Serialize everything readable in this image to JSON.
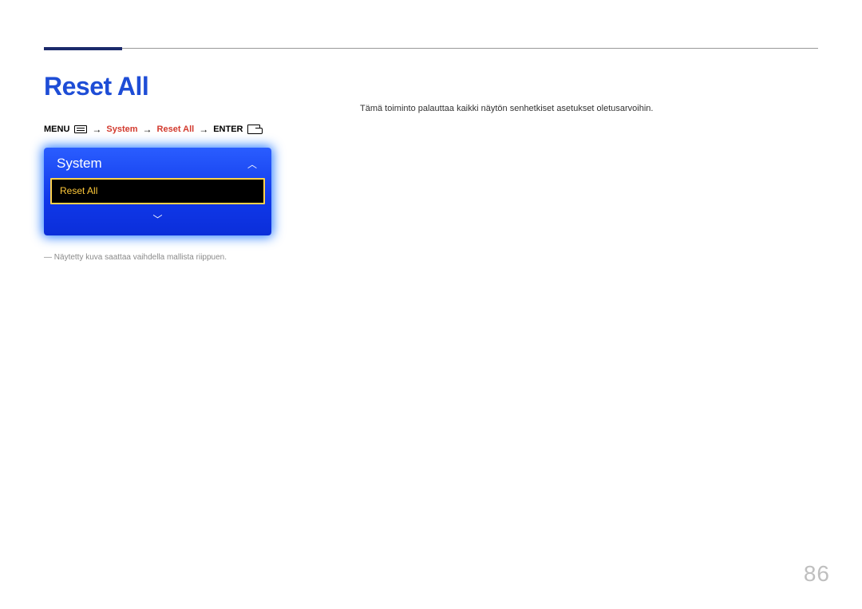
{
  "heading": "Reset All",
  "nav": {
    "menu_label": "MENU",
    "system_label": "System",
    "reset_label": "Reset All",
    "enter_label": "ENTER"
  },
  "tv_menu": {
    "header": "System",
    "selected": "Reset All"
  },
  "note": "Näytetty kuva saattaa vaihdella mallista riippuen.",
  "description": "Tämä toiminto palauttaa kaikki näytön senhetkiset asetukset oletusarvoihin.",
  "page_number": "86"
}
